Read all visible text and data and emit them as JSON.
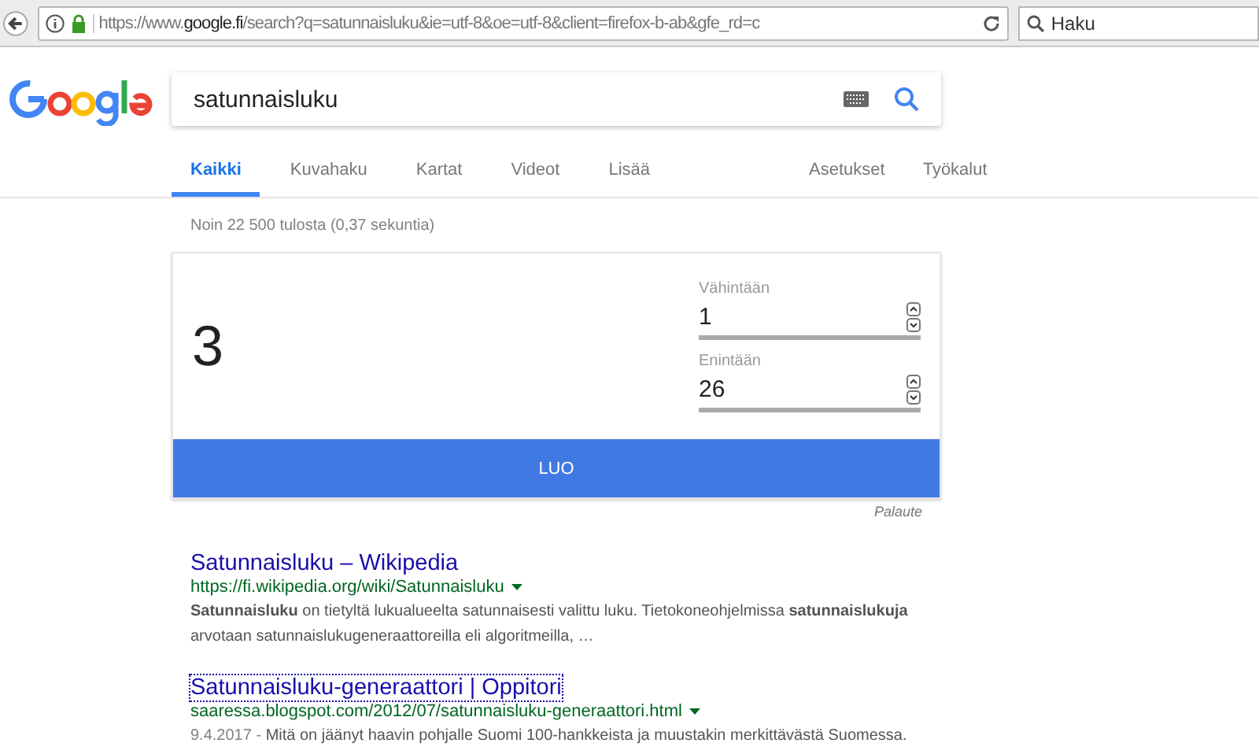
{
  "browser": {
    "url": "https://www.**google.fi**/search?q=satunnaisluku&ie=utf-8&oe=utf-8&client=firefox-b-ab&gfe_rd=c",
    "search_placeholder": "Haku"
  },
  "search": {
    "query": "satunnaisluku"
  },
  "tabs": [
    {
      "label": "Kaikki",
      "selected": true
    },
    {
      "label": "Kuvahaku",
      "selected": false
    },
    {
      "label": "Kartat",
      "selected": false
    },
    {
      "label": "Videot",
      "selected": false
    },
    {
      "label": "Lisää",
      "selected": false
    }
  ],
  "tools": [
    "Asetukset",
    "Työkalut"
  ],
  "result_stats": "Noin 22 500 tulosta (0,37 sekuntia)",
  "generator": {
    "result": "3",
    "fields": [
      {
        "label": "Vähintään",
        "value": "1"
      },
      {
        "label": "Enintään",
        "value": "26"
      }
    ],
    "button": "LUO",
    "feedback": "Palaute"
  },
  "results": [
    {
      "title": "Satunnaisluku – Wikipedia",
      "url": "https://fi.wikipedia.org/wiki/Satunnaisluku",
      "focused": false,
      "snippet": "**Satunnaisluku** on tietyltä lukualueelta satunnaisesti valittu luku. Tietokoneohjelmissa **satunnaislukuja** arvotaan satunnaislukugeneraattoreilla eli algoritmeilla, …"
    },
    {
      "title": "Satunnaisluku-generaattori | Oppitori",
      "url": "saaressa.blogspot.com/2012/07/satunnaisluku-generaattori.html",
      "focused": true,
      "date": "9.4.2017 -",
      "snippet": "Mitä on jäänyt haavin pohjalle Suomi 100-hankkeista ja muustakin merkittävästä Suomessa."
    }
  ]
}
